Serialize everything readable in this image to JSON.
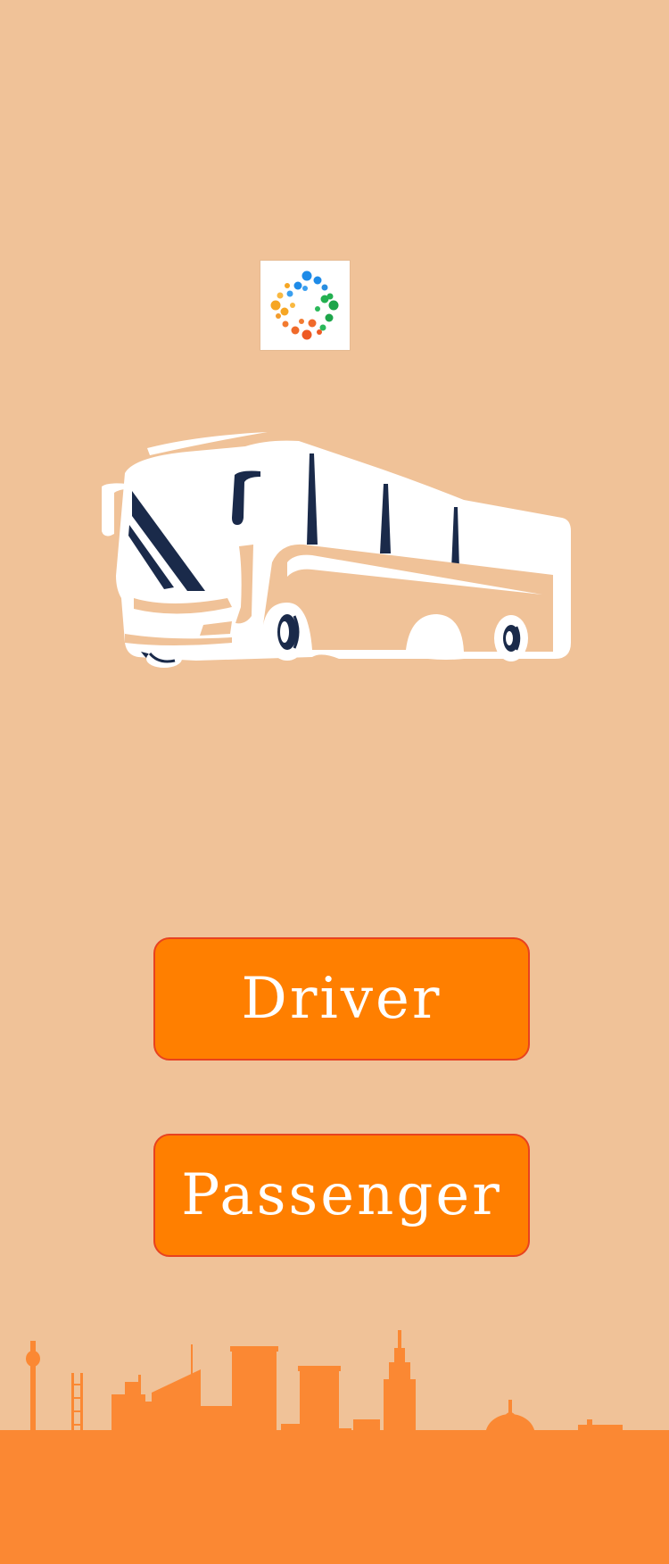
{
  "screen": {
    "background_color": "#F0C298",
    "accent_color": "#FF7F00",
    "button_border_color": "#E8421F",
    "skyline_color": "#FB8833"
  },
  "logo": {
    "icon": "dotted-ring-logo-icon"
  },
  "illustration": {
    "icon": "bus-icon"
  },
  "buttons": {
    "driver_label": "Driver",
    "passenger_label": "Passenger"
  },
  "footer": {
    "icon": "city-skyline-icon"
  }
}
